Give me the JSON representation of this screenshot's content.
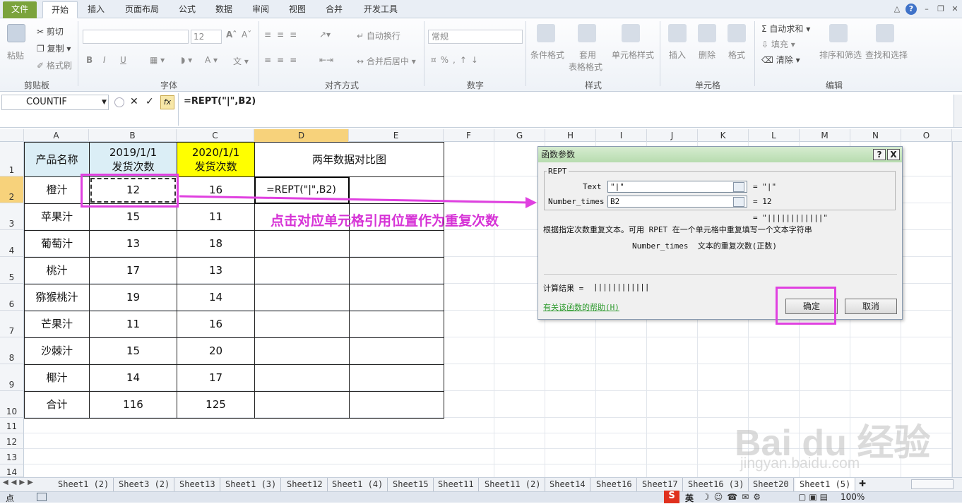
{
  "ribbon_tabs": [
    "文件",
    "开始",
    "插入",
    "页面布局",
    "公式",
    "数据",
    "审阅",
    "视图",
    "合并",
    "开发工具"
  ],
  "clipboard": {
    "paste": "粘贴",
    "cut": "剪切",
    "copy": "复制",
    "format_painter": "格式刷",
    "group": "剪贴板"
  },
  "font": {
    "size": "12",
    "bold": "B",
    "italic": "I",
    "underline": "U",
    "group": "字体"
  },
  "alignment": {
    "wrap": "自动换行",
    "merge": "合并后居中",
    "group": "对齐方式"
  },
  "number": {
    "format": "常规",
    "group": "数字"
  },
  "styles": {
    "conditional": "条件格式",
    "table1": "套用",
    "table2": "表格格式",
    "cell_styles": "单元格样式",
    "group": "样式"
  },
  "cells": {
    "insert": "插入",
    "delete": "删除",
    "format": "格式",
    "group": "单元格"
  },
  "editing": {
    "autosum": "自动求和",
    "fill": "填充",
    "clear": "清除",
    "sort": "排序和筛选",
    "find": "查找和选择",
    "group": "编辑"
  },
  "formula_bar": {
    "name_box": "COUNTIF",
    "fx": "fx",
    "formula": "=REPT(\"|\",B2)"
  },
  "columns": [
    "A",
    "B",
    "C",
    "D",
    "E",
    "F",
    "G",
    "H",
    "I",
    "J",
    "K",
    "L",
    "M",
    "N",
    "O"
  ],
  "rows": [
    "1",
    "2",
    "3",
    "4",
    "5",
    "6",
    "7",
    "8",
    "9",
    "10",
    "11",
    "12",
    "13",
    "14"
  ],
  "table": {
    "headers": [
      "产品名称",
      "2019/1/1\n发货次数",
      "2020/1/1\n发货次数",
      "两年数据对比图"
    ],
    "rows": [
      [
        "橙汁",
        "12",
        "16",
        "=REPT(\"|\",B2)"
      ],
      [
        "苹果汁",
        "15",
        "11",
        ""
      ],
      [
        "葡萄汁",
        "13",
        "18",
        ""
      ],
      [
        "桃汁",
        "17",
        "13",
        ""
      ],
      [
        "猕猴桃汁",
        "19",
        "14",
        ""
      ],
      [
        "芒果汁",
        "11",
        "16",
        ""
      ],
      [
        "沙棘汁",
        "15",
        "20",
        ""
      ],
      [
        "椰汁",
        "14",
        "17",
        ""
      ],
      [
        "合计",
        "116",
        "125",
        ""
      ]
    ]
  },
  "annotation": "点击对应单元格引用位置作为重复次数",
  "dialog": {
    "title": "函数参数",
    "help_btn": "?",
    "close_btn": "X",
    "function": "REPT",
    "arg1_label": "Text",
    "arg1_value": "\"|\"",
    "arg1_result": "= \"|\"",
    "arg2_label": "Number_times",
    "arg2_value": "B2",
    "arg2_result": "= 12",
    "overall_result": "= \"||||||||||||\"",
    "description": "根据指定次数重复文本。可用 RPET 在一个单元格中重复填写一个文本字符串",
    "arg_description": "Number_times  文本的重复次数(正数)",
    "calc_label": "计算结果 =",
    "calc_value": "||||||||||||",
    "help_link": "有关该函数的帮助(H)",
    "ok": "确定",
    "cancel": "取消"
  },
  "sheet_tabs": [
    "Sheet1 (2)",
    "Sheet3 (2)",
    "Sheet13",
    "Sheet1 (3)",
    "Sheet12",
    "Sheet1 (4)",
    "Sheet15",
    "Sheet11",
    "Sheet11 (2)",
    "Sheet14",
    "Sheet16",
    "Sheet17",
    "Sheet16 (3)",
    "Sheet20",
    "Sheet1 (5)"
  ],
  "status": {
    "mode": "点",
    "ime": "英",
    "zoom": "100%"
  },
  "watermark": {
    "line1": "Bai du 经验",
    "line2": "jingyan.baidu.com"
  },
  "colors": {
    "header_blue": "#dbeef6",
    "header_yellow": "#ffff00",
    "accent_pink": "#e040e0",
    "selected_header": "#f7d27b"
  }
}
